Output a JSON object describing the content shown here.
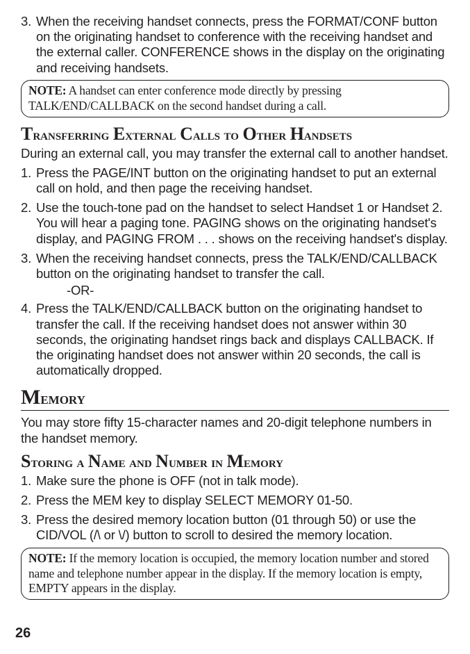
{
  "step3_top": "When the receiving handset connects, press the FORMAT/CONF button on the originating handset to conference with the receiving handset and the external caller. CONFERENCE shows in the display on the originating and receiving handsets.",
  "note1_label": "NOTE:",
  "note1_text": " A handset can enter conference mode directly by pressing TALK/END/CALLBACK on the second handset during a call.",
  "heading_transfer": "Transferring External Calls to Other Handsets",
  "transfer_intro": "During an external call, you may transfer the external call to another handset.",
  "t_step1": "Press the PAGE/INT button on the originating handset to put an external call on hold, and then page the receiving handset.",
  "t_step2": "Use the touch-tone pad on the handset to select Handset 1 or Handset 2. You will hear a paging tone. PAGING shows on the originating handset's display, and PAGING FROM . . . shows on the receiving handset's display.",
  "t_step3": "When the receiving handset connects, press the TALK/END/CALLBACK button on the originating handset to transfer the call.",
  "or_text": "-OR-",
  "t_step4": "Press the TALK/END/CALLBACK button on the originating handset to transfer the call. If the receiving handset does not answer within 30 seconds, the originating handset rings back and displays CALLBACK. If the originating handset does not answer within 20 seconds, the call is automatically dropped.",
  "heading_memory": "Memory",
  "memory_intro": "You may store fifty 15-character names and 20-digit telephone numbers in the handset memory.",
  "heading_storing": "Storing a Name and Number in Memory",
  "m_step1": "Make sure the phone is OFF (not in talk mode).",
  "m_step2": "Press the MEM key to display SELECT MEMORY 01-50.",
  "m_step3": "Press the desired memory location button (01 through 50) or use the CID/VOL (/\\ or \\/) button to scroll to desired the memory location.",
  "note2_label": "NOTE:",
  "note2_text": " If the memory location is occupied, the memory location number and stored name and telephone number appear in the display. If the memory location is empty, EMPTY appears in the display.",
  "page_number": "26"
}
